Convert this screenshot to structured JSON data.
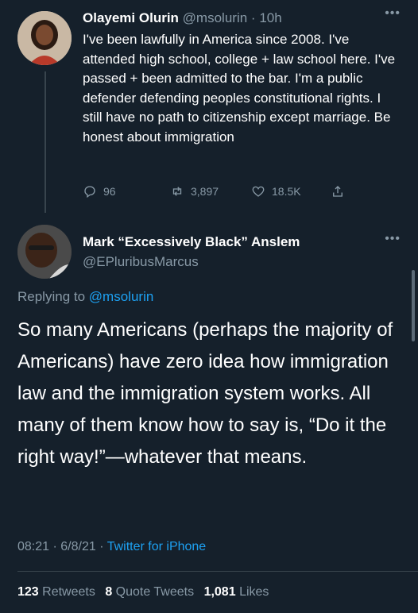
{
  "tweet1": {
    "author_name": "Olayemi Olurin",
    "author_handle": "@msolurin",
    "time": "10h",
    "text": "I've been lawfully in America since 2008. I've attended high school, college + law school here. I've passed + been admitted to the bar. I'm a public defender defending peoples constitutional rights. I still have no path to citizenship except marriage. Be honest about immigration",
    "reply_count": "96",
    "retweet_count": "3,897",
    "like_count": "18.5K"
  },
  "tweet2": {
    "author_name": "Mark “Excessively Black” Anslem",
    "author_handle": "@EPluribusMarcus",
    "replying_prefix": "Replying to",
    "replying_to": "@msolurin",
    "text": "So many Americans (perhaps the majority of Americans) have zero idea how immigration law and the immigration system works. All many of them know how to say is, “Do it the right way!”—whatever that means.",
    "time": "08:21",
    "date": "6/8/21",
    "source": "Twitter for iPhone",
    "retweets_count": "123",
    "retweets_label": "Retweets",
    "quote_tweets_count": "8",
    "quote_tweets_label": "Quote Tweets",
    "likes_count": "1,081",
    "likes_label": "Likes"
  },
  "colors": {
    "background": "#15202b",
    "secondary_text": "#8899a6",
    "link": "#1da1f2",
    "divider": "#38444d"
  }
}
